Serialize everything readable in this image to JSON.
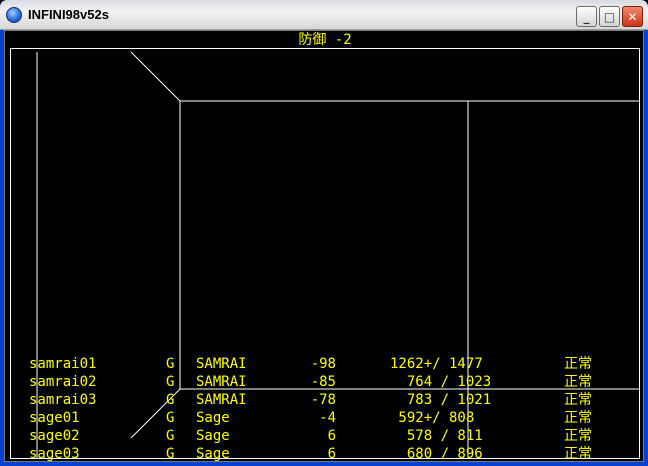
{
  "window": {
    "title": "INFINI98v52s",
    "icon": "globe-icon",
    "buttons": {
      "minimize": "_",
      "maximize": "□",
      "close": "✕"
    }
  },
  "game": {
    "heading": "防御 -2",
    "party": [
      {
        "name": "samrai01",
        "alignment": "G",
        "class": "SAMRAI",
        "ac": "-98",
        "hp": "1262+/ 1477",
        "status": "正常"
      },
      {
        "name": "samrai02",
        "alignment": "G",
        "class": "SAMRAI",
        "ac": "-85",
        "hp": "  764 / 1023",
        "status": "正常"
      },
      {
        "name": "samrai03",
        "alignment": "G",
        "class": "SAMRAI",
        "ac": "-78",
        "hp": "  783 / 1021",
        "status": "正常"
      },
      {
        "name": "sage01",
        "alignment": "G",
        "class": "Sage",
        "ac": "-4",
        "hp": " 592+/ 808",
        "status": "正常"
      },
      {
        "name": "sage02",
        "alignment": "G",
        "class": "Sage",
        "ac": "6",
        "hp": "  578 / 811",
        "status": "正常"
      },
      {
        "name": "sage03",
        "alignment": "G",
        "class": "Sage",
        "ac": "6",
        "hp": "  680 / 896",
        "status": "正常"
      }
    ]
  },
  "colors": {
    "text": "#ffff00",
    "lines": "#ffffff",
    "background": "#000000"
  }
}
